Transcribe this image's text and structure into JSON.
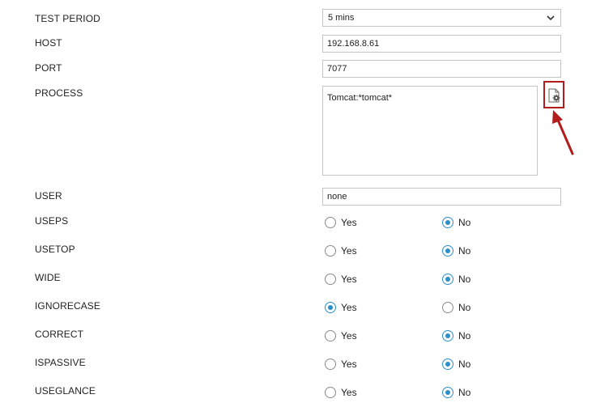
{
  "fields": {
    "test_period": {
      "label": "TEST PERIOD",
      "value": "5 mins"
    },
    "host": {
      "label": "HOST",
      "value": "192.168.8.61"
    },
    "port": {
      "label": "PORT",
      "value": "7077"
    },
    "process": {
      "label": "PROCESS",
      "value": "Tomcat:*tomcat*"
    },
    "user": {
      "label": "USER",
      "value": "none"
    }
  },
  "radio_labels": {
    "yes": "Yes",
    "no": "No"
  },
  "radio_rows": [
    {
      "label": "USEPS",
      "selected": "no"
    },
    {
      "label": "USETOP",
      "selected": "no"
    },
    {
      "label": "WIDE",
      "selected": "no"
    },
    {
      "label": "IGNORECASE",
      "selected": "yes"
    },
    {
      "label": "CORRECT",
      "selected": "no"
    },
    {
      "label": "ISPASSIVE",
      "selected": "no"
    },
    {
      "label": "USEGLANCE",
      "selected": "no"
    }
  ],
  "icons": {
    "process_helper": "document-gear-icon",
    "annotation_arrow": "red-arrow-icon"
  },
  "colors": {
    "highlight_border": "#b21c1c",
    "radio_selected": "#2b8fc7"
  }
}
